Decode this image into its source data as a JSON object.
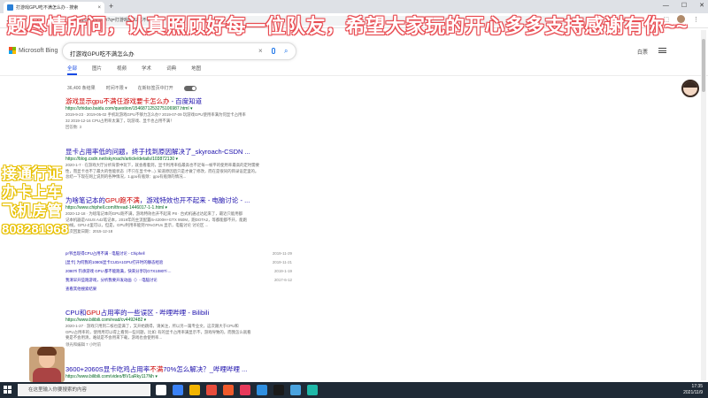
{
  "browser": {
    "tab_title": "打游戏GPU吃不满怎么办 - 搜索",
    "tab_close": "×",
    "new_tab": "+",
    "window_controls": [
      "—",
      "☐",
      "✕"
    ],
    "nav_buttons": [
      "←",
      "→",
      "⟳"
    ],
    "address": "cn.bing.com/search?q=打游戏GPU吃不满怎么办"
  },
  "overlay": {
    "banner": "题尽情所问，认真照顾好每一位队友，希望大家玩的开心多多支持感谢有你~~",
    "side_lines": [
      "接通行证",
      "办卡上车",
      "飞机房管"
    ],
    "phone": "808281968"
  },
  "bing": {
    "logo_text": "Microsoft Bing",
    "logo_colors": [
      "#f25022",
      "#7fba00",
      "#00a4ef",
      "#ffb900"
    ],
    "query": "打游戏GPU吃不满怎么办",
    "header_right": [
      "白票",
      "≡"
    ],
    "scopes": [
      "全部",
      "图片",
      "视频",
      "学术",
      "词典",
      "地图"
    ],
    "active_scope": "全部",
    "filters": {
      "count": "36,400 条结果",
      "time": "时间不限 ▾",
      "open_links": "在新标签页中打开"
    }
  },
  "results": [
    {
      "title_pre": "",
      "title_hl": "游戏显示gpu不满任游戏要卡怎么办",
      "title_post": " - 百度知道",
      "url": "https://zhidao.baidu.com/question/1546871253275106987.html ▾",
      "snippet": [
        "2019-9-23 · 2019-05-02 手机玩游戏GPU不够力怎么办? 2019-07-09 玩游戏GPU使用率满为何显卡占用率",
        "32 2019-12-16 CPU占用率太满了，玩游戏、显卡也占用不满！"
      ],
      "meta": "回答数: 3"
    },
    {
      "title_pre": "显卡占用率低的问题，终于找到原因解决了_skyroach-CSDN ...",
      "title_hl": "",
      "title_post": "",
      "url": "https://blog.csdn.net/skyroach/article/details/103872130 ▾",
      "snippet": [
        "2020-1-7 · 在游戏大厅分析背景中玩下，就会看着到，显卡利用率低最高也不足每一帧平的使用率最高的定时需要",
        "性，而显卡也不了最大的性能状态（不只在显卡中...). 知道原因后只是才做了修改，而在是很同的目录设定里的。",
        "总结一下现在网上说到的各种情况，1.gpu有瓶颈：gpu有瓶颈的情况..."
      ],
      "meta": ""
    },
    {
      "title_pre": "为啥笔记本的",
      "title_hl": "GPU跑不满",
      "title_post": "，游戏特效也开不起来 - 电脑讨论 - ...",
      "url": "https://www.chiphell.com/thread-1446017-1-1.html ▾",
      "snippet": [
        "2020-12-18 · 为啥笔记本的GPU跑不满，游戏特效也开不起来 P8 · 台式机通过达起来了，最近只能用都",
        "记本机器是ASUS A42笔记本，2019年的主流配置i5-4200H+GTX 950M，跑DOTA2，等都能都不开，能跑",
        "30帧。GPU-Z里可以，但是，GPU利用率能到70%GPUs 显示，电脑讨论 讨论区 ...",
        "上次回复日期：2015-12-18"
      ],
      "meta": ""
    },
    {
      "title_pre": "CPU和",
      "title_hl": "GPU",
      "title_post": "占用率的一些误区 - 哔哩哔哩 - Bilibili",
      "url": "https://www.bilibili.com/read/cv4492482 ▾",
      "snippet": [
        "2020-1-27 · 游戏只用到二核也是满了，又开始跳得，请关注，所以另一篇专业文，这次跟大于CPU和",
        "GPU占用率的，使用用可以得上看到一些问题，比如: 有的显卡占用率满显示不，游戏导致的，而我怎么就看",
        "要是不会用清，难就是不会用来下载，游戏也会使用率..."
      ],
      "meta": "领光和编辑 7 小时前"
    },
    {
      "title_pre": "3600+2060S显卡吃鸡占用率",
      "title_hl": "不满",
      "title_post": "70%怎么解决？_哔哩哔哩 ...",
      "url": "https://www.bilibili.com/video/BV1aRky117Nh ▾",
      "snippet": [],
      "meta": ""
    }
  ],
  "sublinks": [
    {
      "title": "pr爷出现得CPU占用不满 - 电脑讨论 - Chiphell",
      "date": "2019-11-29"
    },
    {
      "title": "[显卡] 为何我的1080ti显卡CUDA1GPU打开时的静态经验",
      "date": "2019-11-21"
    },
    {
      "title": "2080Ti 钓承游戏 GPU 都不能跑满，快来分享玩GTX1080Ti ...",
      "date": "2019-1-19"
    },
    {
      "title": "我清早开些跑游戏，分析我要开发动画（）- 电脑讨论",
      "date": "2017-6-12"
    }
  ],
  "sublinks_more": "查看其他搜索结果",
  "taskbar": {
    "search_placeholder": "在这里输入你要搜索的内容",
    "icon_colors": [
      "#ffffff",
      "#3a82f7",
      "#f2b400",
      "#e74c3c",
      "#f05a2b",
      "#e63a5c",
      "#2f8fe0",
      "#1a1a1a",
      "#4aa3df",
      "#1fb8a8"
    ],
    "time": "17:35",
    "date": "2021/11/9"
  }
}
